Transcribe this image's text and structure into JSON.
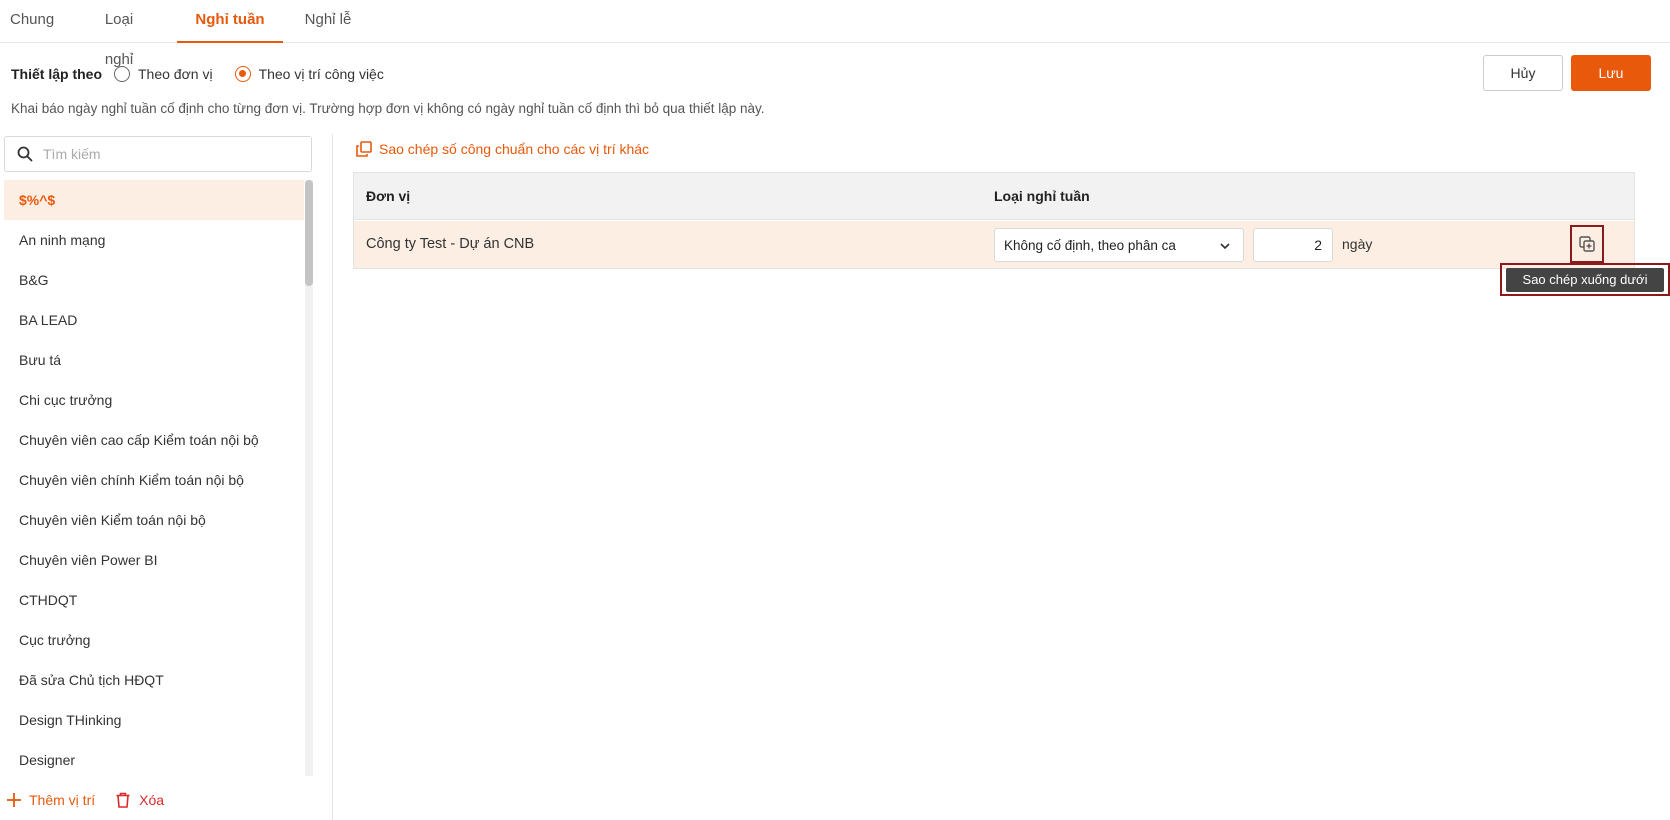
{
  "tabs": [
    {
      "label": "Chung",
      "active": false
    },
    {
      "label": "Loại nghỉ",
      "active": false
    },
    {
      "label": "Nghỉ tuần",
      "active": true
    },
    {
      "label": "Nghỉ lễ",
      "active": false
    }
  ],
  "settings": {
    "label": "Thiết lập theo",
    "options": [
      {
        "label": "Theo đơn vị",
        "checked": false
      },
      {
        "label": "Theo vị trí công việc",
        "checked": true
      }
    ]
  },
  "buttons": {
    "cancel": "Hủy",
    "save": "Lưu"
  },
  "description": "Khai báo ngày nghỉ tuần cố định cho từng đơn vị. Trường hợp đơn vị không có ngày nghỉ tuần cố định thì bỏ qua thiết lập này.",
  "search": {
    "placeholder": "Tìm kiếm"
  },
  "positions": [
    "$%^$",
    "An ninh mạng",
    "B&G",
    "BA LEAD",
    "Bưu tá",
    "Chi cục trưởng",
    "Chuyên viên cao cấp Kiểm toán nội bộ",
    "Chuyên viên chính Kiểm toán nội bộ",
    "Chuyên viên Kiểm toán nội bộ",
    "Chuyên viên Power BI",
    "CTHDQT",
    "Cục trưởng",
    "Đã sửa Chủ tịch HĐQT",
    "Design THinking",
    "Designer"
  ],
  "selected_position": "$%^$",
  "left_actions": {
    "add": "Thêm vị trí",
    "delete": "Xóa"
  },
  "copy_link": "Sao chép số công chuẩn cho các vị trí khác",
  "table": {
    "headers": {
      "unit": "Đơn vị",
      "type": "Loại nghỉ tuần"
    },
    "rows": [
      {
        "unit": "Công ty Test - Dự án CNB",
        "type": "Không cố định, theo phân ca",
        "days": "2",
        "days_unit": "ngày"
      }
    ]
  },
  "tooltip": "Sao chép xuống dưới",
  "colors": {
    "accent": "#e8590c",
    "danger": "#d92b2b",
    "highlight": "#8b1a1a",
    "selected_bg": "#fdeee3"
  }
}
